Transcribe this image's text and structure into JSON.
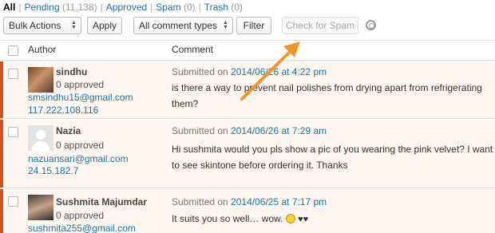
{
  "filters": {
    "all": "All",
    "pending": "Pending",
    "pending_count": "(11,138)",
    "approved": "Approved",
    "spam": "Spam",
    "spam_count": "(0)",
    "trash": "Trash",
    "trash_count": "(0)",
    "separator": "|"
  },
  "toolbar": {
    "bulk_actions": "Bulk Actions",
    "apply": "Apply",
    "comment_types": "All comment types",
    "filter": "Filter",
    "check_spam": "Check for Spam"
  },
  "table": {
    "col_author": "Author",
    "col_comment": "Comment"
  },
  "comments": [
    {
      "author": "sindhu",
      "approved": "0 approved",
      "email": "smsindhu15@gmail.com",
      "ip": "117.222.108.116",
      "submitted_prefix": "Submitted on",
      "date": "2014/06/26 at 4:22 pm",
      "text": "is there a way to prevent nail polishes from drying apart from refrigerating them?"
    },
    {
      "author": "Nazia",
      "approved": "0 approved",
      "email": "nazuansari@gmail.com",
      "ip": "24.15.182.7",
      "submitted_prefix": "Submitted on",
      "date": "2014/06/26 at 7:29 am",
      "text": "Hi sushmita would you pls show a pic of you wearing the pink velvet? I want to see skintone before ordering it. Thanks"
    },
    {
      "author": "Sushmita Majumdar",
      "approved": "0 approved",
      "email": "sushmita255@gmail.com",
      "submitted_prefix": "Submitted on",
      "date": "2014/06/25 at 7:17 pm",
      "text": "It suits you so well… wow.",
      "hearts": "♥♥"
    }
  ],
  "annotation": {
    "arrow_color": "#f0962a"
  },
  "colors": {
    "link": "#21759b",
    "pending_bar": "#d54e21",
    "row_bg": "#fef7f1"
  }
}
